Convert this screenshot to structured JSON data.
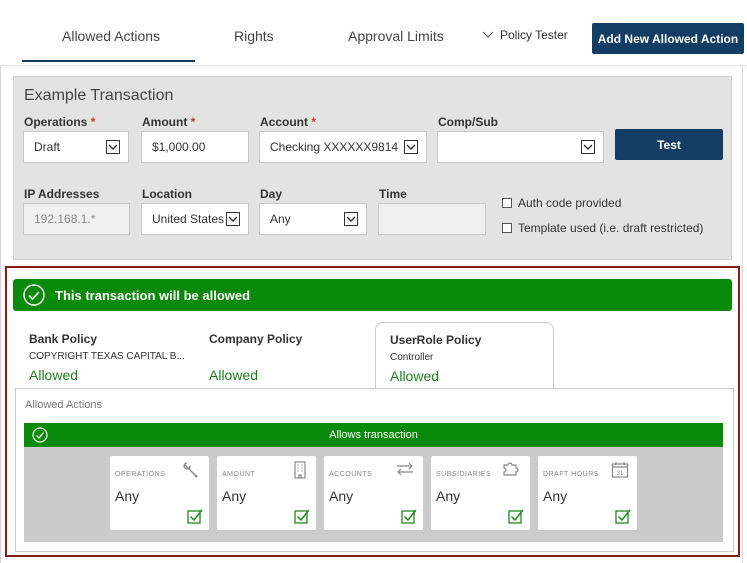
{
  "tabs": [
    {
      "label": "Allowed Actions",
      "active": true
    },
    {
      "label": "Rights",
      "active": false
    },
    {
      "label": "Approval Limits",
      "active": false
    }
  ],
  "policy_tester": {
    "label": "Policy Tester",
    "icon": "chevron-down-icon"
  },
  "add_button": {
    "label": "Add New Allowed Action"
  },
  "example": {
    "title": "Example Transaction",
    "operations": {
      "label": "Operations",
      "required": "*",
      "value": "Draft"
    },
    "amount": {
      "label": "Amount",
      "required": "*",
      "value": "$1,000.00"
    },
    "account": {
      "label": "Account",
      "required": "*",
      "value": "Checking XXXXXX9814"
    },
    "comp_sub": {
      "label": "Comp/Sub",
      "value": ""
    },
    "test_button": "Test",
    "ip": {
      "label": "IP Addresses",
      "value": "192.168.1.*"
    },
    "location": {
      "label": "Location",
      "value": "United States"
    },
    "day": {
      "label": "Day",
      "value": "Any"
    },
    "time": {
      "label": "Time",
      "value": ""
    },
    "auth_code": {
      "label": "Auth code provided",
      "checked": false
    },
    "template_used": {
      "label": "Template used (i.e. draft restricted)",
      "checked": false
    }
  },
  "result": {
    "banner": "This transaction will be allowed",
    "banner_color": "#0a8a0a",
    "policies": [
      {
        "title": "Bank Policy",
        "subtitle": "COPYRIGHT TEXAS CAPITAL B...",
        "status": "Allowed"
      },
      {
        "title": "Company Policy",
        "subtitle": "",
        "status": "Allowed"
      },
      {
        "title": "UserRole Policy",
        "subtitle": "Controller",
        "status": "Allowed",
        "active": true
      }
    ],
    "detail": {
      "label": "Allowed Actions",
      "allows_label": "Allows transaction",
      "cards": [
        {
          "label": "OPERATIONS",
          "value": "Any",
          "icon": "wrench-icon"
        },
        {
          "label": "AMOUNT",
          "value": "Any",
          "icon": "building-icon"
        },
        {
          "label": "ACCOUNTS",
          "value": "Any",
          "icon": "transfer-arrows-icon"
        },
        {
          "label": "SUBSIDIARIES",
          "value": "Any",
          "icon": "puzzle-icon"
        },
        {
          "label": "DRAFT HOURS",
          "value": "Any",
          "icon": "calendar-icon",
          "icon_text": "31"
        }
      ]
    }
  },
  "colors": {
    "primary": "#143d66",
    "success": "#0a8a0a",
    "highlight_border": "#8b1c1c"
  }
}
